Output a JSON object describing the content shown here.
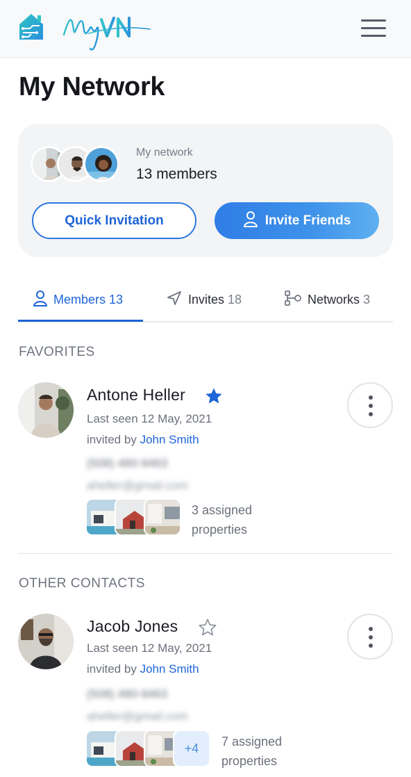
{
  "header": {
    "logo_text": "MyVN",
    "menu_icon": "hamburger-menu-icon"
  },
  "page_title": "My Network",
  "network_card": {
    "label": "My network",
    "count": "13 members",
    "quick_invitation": "Quick Invitation",
    "invite_friends": "Invite Friends"
  },
  "tabs": [
    {
      "label": "Members",
      "count": "13",
      "icon": "user-icon",
      "active": true
    },
    {
      "label": "Invites",
      "count": "18",
      "icon": "send-icon",
      "active": false
    },
    {
      "label": "Networks",
      "count": "3",
      "icon": "network-icon",
      "active": false
    }
  ],
  "sections": {
    "favorites": "FAVORITES",
    "other": "OTHER CONTACTS"
  },
  "contacts": [
    {
      "name": "Antone Heller",
      "favorite": true,
      "last_seen": "Last seen 12 May, 2021",
      "invited_by_prefix": "invited by",
      "invited_by": "John Smith",
      "phone": "(508) 480-9463",
      "email": "aheller@gmail.com",
      "properties_label": "3 assigned properties",
      "more_count": ""
    },
    {
      "name": "Jacob Jones",
      "favorite": false,
      "last_seen": "Last seen 12 May, 2021",
      "invited_by_prefix": "invited by",
      "invited_by": "John Smith",
      "phone": "(508) 480-9463",
      "email": "aheller@gmail.com",
      "properties_label": "7 assigned properties",
      "more_count": "+4"
    }
  ],
  "colors": {
    "accent": "#1d64d6",
    "logo": "#2fb9cf",
    "card_bg": "#f3f4f6"
  }
}
